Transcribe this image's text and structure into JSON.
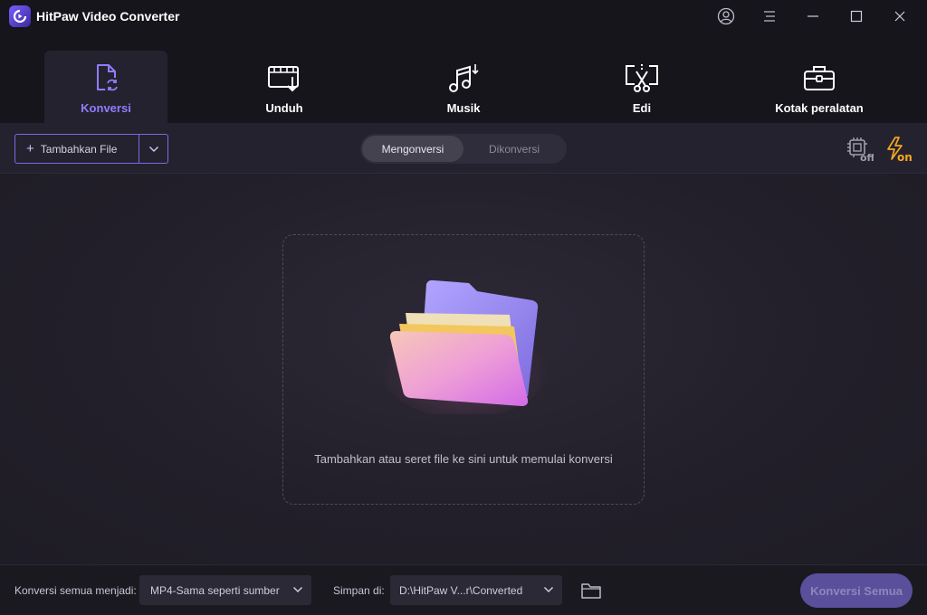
{
  "app": {
    "title": "HitPaw Video Converter"
  },
  "window_controls": [
    "account-icon",
    "menu-icon",
    "minimize-icon",
    "maximize-icon",
    "close-icon"
  ],
  "nav": {
    "active": "Konversi",
    "tabs": [
      {
        "label": "Konversi",
        "icon": "convert-file-icon"
      },
      {
        "label": "Unduh",
        "icon": "video-download-icon"
      },
      {
        "label": "Musik",
        "icon": "music-icon"
      },
      {
        "label": "Edi",
        "icon": "edit-cut-icon"
      },
      {
        "label": "Kotak peralatan",
        "icon": "toolbox-icon"
      }
    ]
  },
  "toolbar": {
    "add_file_label": "Tambahkan File",
    "segment": {
      "tabs": [
        "Mengonversi",
        "Dikonversi"
      ],
      "active": "Mengonversi"
    },
    "hardware_accel": {
      "icon": "hardware-acceleration-icon",
      "state": "off"
    },
    "lossless_speed": {
      "icon": "lightning-icon",
      "state": "on"
    }
  },
  "workspace": {
    "drop_hint": "Tambahkan atau seret file ke sini untuk memulai konversi"
  },
  "footer": {
    "convert_all_to_label": "Konversi semua menjadi:",
    "format_value": "MP4-Sama seperti sumber",
    "save_to_label": "Simpan di:",
    "save_path": "D:\\HitPaw V...r\\Converted",
    "convert_all_button": "Konversi Semua"
  },
  "colors": {
    "accent": "#8f7dff",
    "bolt": "#f5a623",
    "button_disabled": "#5a4f9a",
    "background": "#1c1a24"
  }
}
